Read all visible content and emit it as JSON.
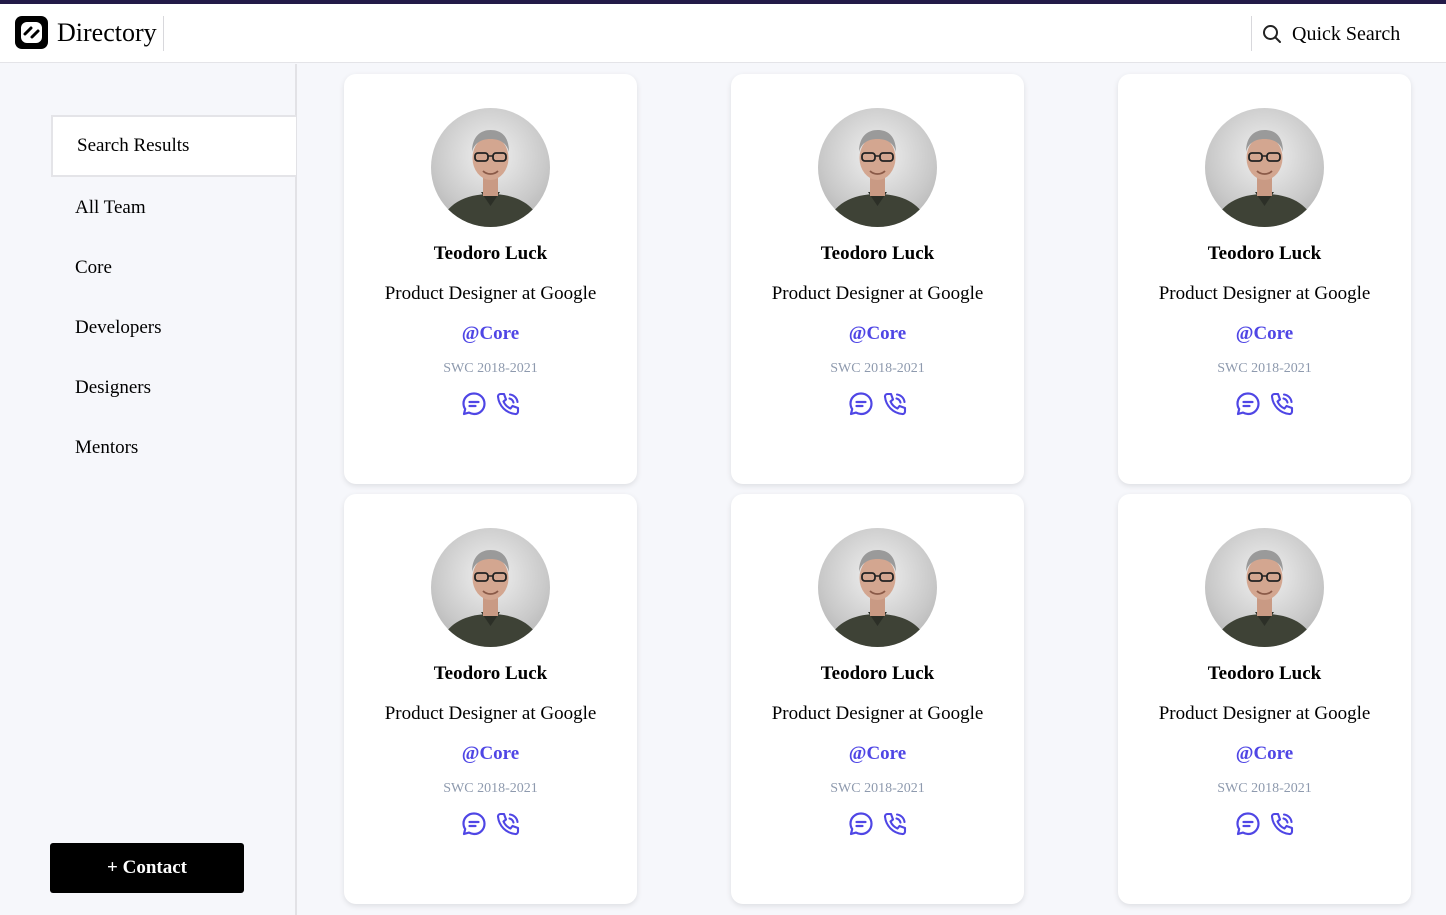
{
  "app": {
    "title": "Directory"
  },
  "header": {
    "search_label": "Quick Search"
  },
  "sidebar": {
    "items": [
      {
        "label": "Search Results",
        "active": true
      },
      {
        "label": "All Team"
      },
      {
        "label": "Core"
      },
      {
        "label": "Developers"
      },
      {
        "label": "Designers"
      },
      {
        "label": "Mentors"
      }
    ],
    "contact_button": "+ Contact"
  },
  "colors": {
    "accent": "#4f46e5",
    "topline": "#231a48",
    "muted": "#8e9aae"
  },
  "cards": [
    {
      "name": "Teodoro Luck",
      "role": "Product Designer at Google",
      "team": "@Core",
      "period": "SWC 2018-2021"
    },
    {
      "name": "Teodoro Luck",
      "role": "Product Designer at Google",
      "team": "@Core",
      "period": "SWC 2018-2021"
    },
    {
      "name": "Teodoro Luck",
      "role": "Product Designer at Google",
      "team": "@Core",
      "period": "SWC 2018-2021"
    },
    {
      "name": "Teodoro Luck",
      "role": "Product Designer at Google",
      "team": "@Core",
      "period": "SWC 2018-2021"
    },
    {
      "name": "Teodoro Luck",
      "role": "Product Designer at Google",
      "team": "@Core",
      "period": "SWC 2018-2021"
    },
    {
      "name": "Teodoro Luck",
      "role": "Product Designer at Google",
      "team": "@Core",
      "period": "SWC 2018-2021"
    }
  ],
  "icons": {
    "chat": "chat-bubble-icon",
    "phone": "phone-call-icon",
    "search": "search-icon"
  }
}
